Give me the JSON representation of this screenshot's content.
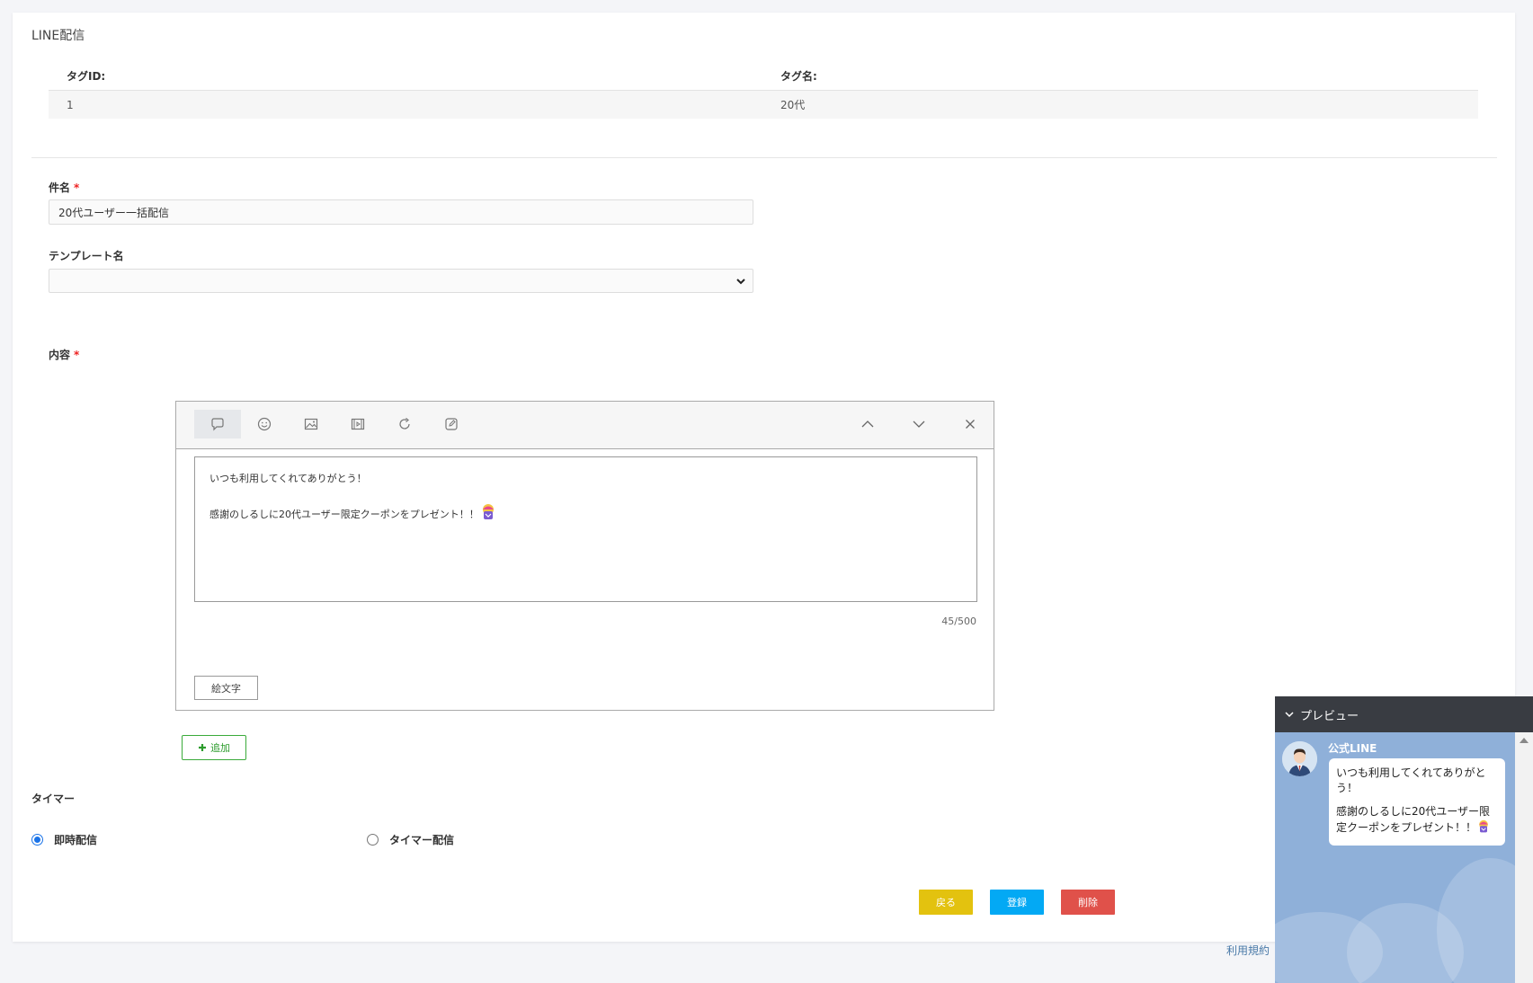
{
  "page": {
    "title": "LINE配信"
  },
  "tag_table": {
    "headers": [
      "タグID:",
      "タグ名:"
    ],
    "rows": [
      {
        "id": "1",
        "name": "20代"
      }
    ]
  },
  "form": {
    "subject_label": "件名",
    "subject_value": "20代ユーザー一括配信",
    "template_label": "テンプレート名",
    "template_value": "",
    "content_label": "内容",
    "required_mark": "*"
  },
  "editor": {
    "toolbar_icons": [
      "speech-bubble-icon",
      "smiley-icon",
      "image-icon",
      "video-icon",
      "refresh-icon",
      "edit-icon"
    ],
    "controls": [
      "move-up-icon",
      "move-down-icon",
      "close-icon"
    ],
    "lines": [
      "いつも利用してくれてありがとう！",
      "感謝のしるしに20代ユーザー限定クーポンをプレゼント！！"
    ],
    "counter": "45/500",
    "emoji_button": "絵文字"
  },
  "add_button": "追加",
  "timer": {
    "title": "タイマー",
    "options": [
      {
        "label": "即時配信",
        "checked": true
      },
      {
        "label": "タイマー配信",
        "checked": false
      }
    ]
  },
  "actions": {
    "back": "戻る",
    "register": "登録",
    "delete": "削除"
  },
  "colors": {
    "back": "#e3c20f",
    "register": "#03a9f4",
    "delete": "#e0514a",
    "add": "#2c9c2c",
    "preview_bg": "#8fb0d9",
    "preview_head": "#393c42"
  },
  "footer": {
    "terms_link": "利用規約"
  },
  "preview": {
    "title": "プレビュー",
    "sender": "公式LINE",
    "message_lines": [
      "いつも利用してくれてありがとう！",
      "感謝のしるしに20代ユーザー限定クーポンをプレゼント！！"
    ]
  }
}
